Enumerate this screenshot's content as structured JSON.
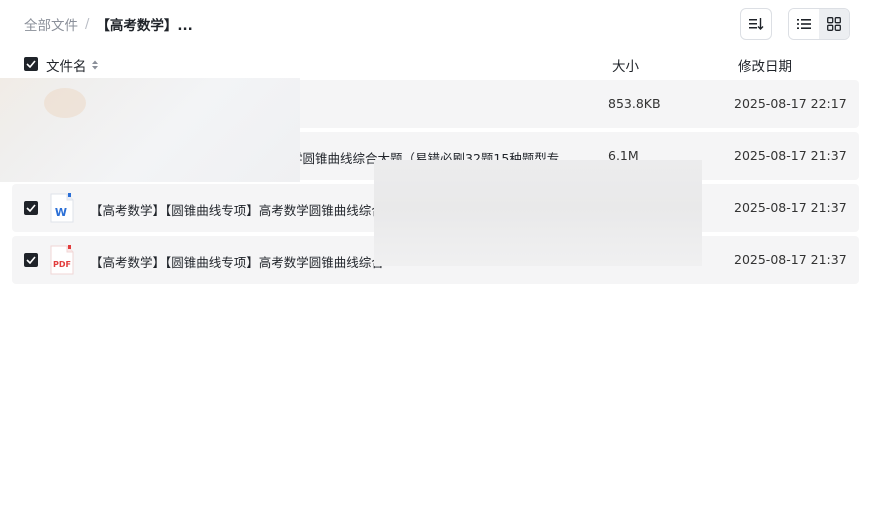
{
  "breadcrumb": {
    "root": "全部文件",
    "separator": "/",
    "current": "【高考数学】..."
  },
  "toolbar": {
    "sort_icon": "sort-icon",
    "list_icon": "list-view-icon",
    "grid_icon": "grid-view-icon",
    "active_view": "list"
  },
  "columns": {
    "name": "文件名",
    "size": "大小",
    "date": "修改日期"
  },
  "files": [
    {
      "name": "",
      "size": "853.8KB",
      "date": "2025-08-17 22:17",
      "icon": "image-file-icon",
      "checked": false
    },
    {
      "name": "学圆锥曲线综合大题（易错必刷32题15种题型专...",
      "size": "6.1M",
      "date": "2025-08-17 21:37",
      "icon": "file-icon",
      "checked": false
    },
    {
      "name": "【高考数学】【圆锥曲线专项】高考数学圆锥曲线综合",
      "size": "",
      "date": "2025-08-17 21:37",
      "icon": "word-file-icon",
      "checked": true
    },
    {
      "name": "【高考数学】【圆锥曲线专项】高考数学圆锥曲线综合",
      "size": "",
      "date": "2025-08-17 21:37",
      "icon": "pdf-file-icon",
      "checked": true
    }
  ],
  "colors": {
    "row_bg": "#f5f5f6",
    "checkbox": "#1f2329",
    "word_blue": "#2b6fd6",
    "pdf_red": "#e23c3c"
  }
}
